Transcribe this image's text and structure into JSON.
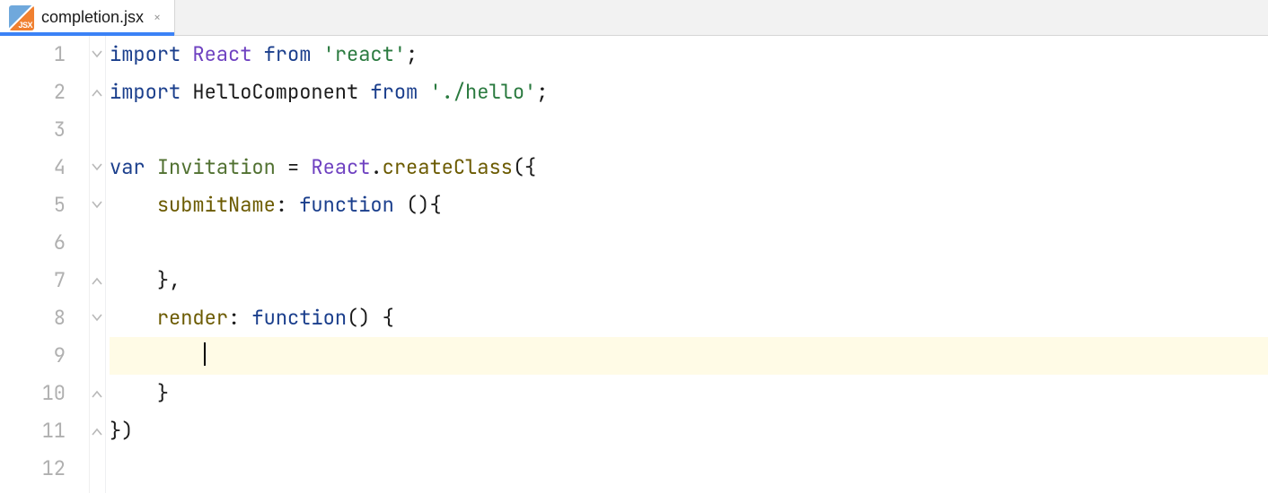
{
  "tab": {
    "filename": "completion.jsx",
    "badge_text": "JSX",
    "close_glyph": "×"
  },
  "gutter": {
    "lines": [
      "1",
      "2",
      "3",
      "4",
      "5",
      "6",
      "7",
      "8",
      "9",
      "10",
      "11",
      "12"
    ]
  },
  "fold_markers": [
    {
      "line": 1,
      "kind": "open"
    },
    {
      "line": 2,
      "kind": "close"
    },
    {
      "line": 4,
      "kind": "open"
    },
    {
      "line": 5,
      "kind": "open"
    },
    {
      "line": 7,
      "kind": "close"
    },
    {
      "line": 8,
      "kind": "open"
    },
    {
      "line": 10,
      "kind": "close"
    },
    {
      "line": 11,
      "kind": "close"
    }
  ],
  "code": {
    "lines": [
      {
        "n": 1,
        "tokens": [
          {
            "t": "import ",
            "c": "kw"
          },
          {
            "t": "React ",
            "c": "cls"
          },
          {
            "t": "from ",
            "c": "kw"
          },
          {
            "t": "'react'",
            "c": "str"
          },
          {
            "t": ";",
            "c": "punc"
          }
        ]
      },
      {
        "n": 2,
        "tokens": [
          {
            "t": "import ",
            "c": "kw"
          },
          {
            "t": "HelloComponent ",
            "c": "id"
          },
          {
            "t": "from ",
            "c": "kw"
          },
          {
            "t": "'./hello'",
            "c": "str"
          },
          {
            "t": ";",
            "c": "punc"
          }
        ]
      },
      {
        "n": 3,
        "tokens": []
      },
      {
        "n": 4,
        "tokens": [
          {
            "t": "var ",
            "c": "kw"
          },
          {
            "t": "Invitation ",
            "c": "def"
          },
          {
            "t": "= ",
            "c": "punc"
          },
          {
            "t": "React",
            "c": "cls"
          },
          {
            "t": ".",
            "c": "punc"
          },
          {
            "t": "createClass",
            "c": "prop"
          },
          {
            "t": "({",
            "c": "punc"
          }
        ]
      },
      {
        "n": 5,
        "tokens": [
          {
            "t": "    ",
            "c": "punc"
          },
          {
            "t": "submitName",
            "c": "prop"
          },
          {
            "t": ": ",
            "c": "punc"
          },
          {
            "t": "function ",
            "c": "kw"
          },
          {
            "t": "(){",
            "c": "punc"
          }
        ]
      },
      {
        "n": 6,
        "tokens": []
      },
      {
        "n": 7,
        "tokens": [
          {
            "t": "    ",
            "c": "punc"
          },
          {
            "t": "},",
            "c": "punc"
          }
        ]
      },
      {
        "n": 8,
        "tokens": [
          {
            "t": "    ",
            "c": "punc"
          },
          {
            "t": "render",
            "c": "prop"
          },
          {
            "t": ": ",
            "c": "punc"
          },
          {
            "t": "function",
            "c": "kw"
          },
          {
            "t": "() {",
            "c": "punc"
          }
        ]
      },
      {
        "n": 9,
        "current": true,
        "caret": true,
        "tokens": [
          {
            "t": "        ",
            "c": "punc"
          }
        ]
      },
      {
        "n": 10,
        "tokens": [
          {
            "t": "    ",
            "c": "punc"
          },
          {
            "t": "}",
            "c": "punc"
          }
        ]
      },
      {
        "n": 11,
        "tokens": [
          {
            "t": "})",
            "c": "punc"
          }
        ]
      },
      {
        "n": 12,
        "tokens": []
      }
    ]
  }
}
